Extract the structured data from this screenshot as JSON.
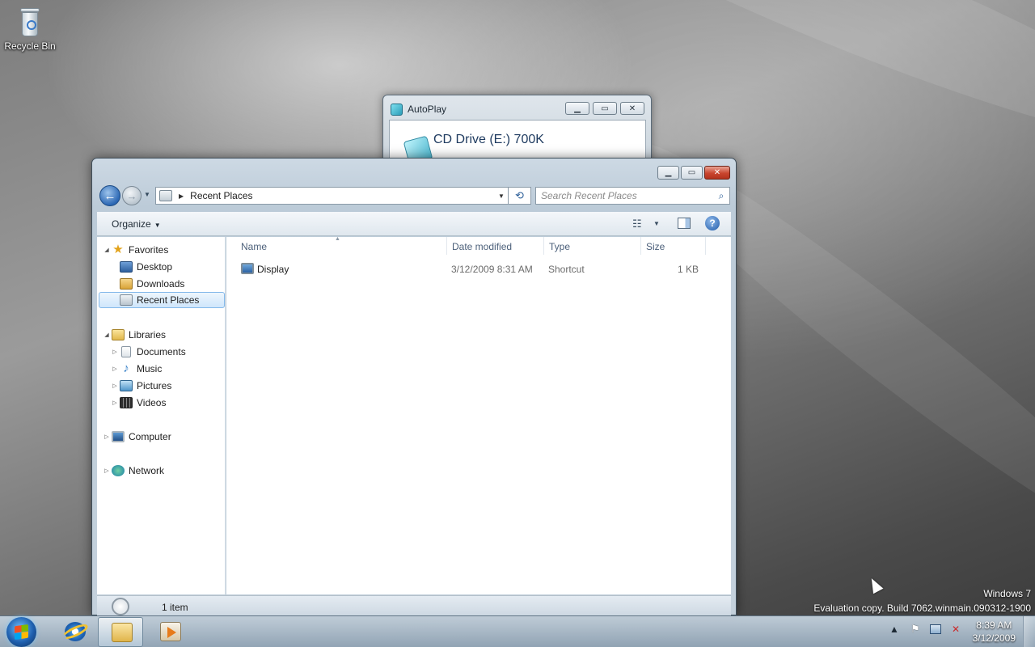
{
  "desktop": {
    "recycle_bin_label": "Recycle Bin",
    "watermark_line1": "Windows 7",
    "watermark_line2": "Evaluation copy. Build 7062.winmain.090312-1900"
  },
  "autoplay": {
    "title": "AutoPlay",
    "drive_label": "CD Drive (E:) 700K"
  },
  "explorer": {
    "address_path": "Recent Places",
    "search_placeholder": "Search Recent Places",
    "organize_label": "Organize",
    "nav": {
      "favorites": "Favorites",
      "desktop": "Desktop",
      "downloads": "Downloads",
      "recent_places": "Recent Places",
      "libraries": "Libraries",
      "documents": "Documents",
      "music": "Music",
      "pictures": "Pictures",
      "videos": "Videos",
      "computer": "Computer",
      "network": "Network"
    },
    "columns": {
      "name": "Name",
      "date_modified": "Date modified",
      "type": "Type",
      "size": "Size"
    },
    "files": [
      {
        "name": "Display",
        "date_modified": "3/12/2009 8:31 AM",
        "type": "Shortcut",
        "size": "1 KB"
      }
    ],
    "status_text": "1 item"
  },
  "taskbar": {
    "clock_time": "8:39 AM",
    "clock_date": "3/12/2009"
  },
  "icons": {
    "start": "windows-orb-icon",
    "browser": "internet-explorer-icon",
    "explorer": "folder-icon",
    "media": "media-player-icon"
  }
}
